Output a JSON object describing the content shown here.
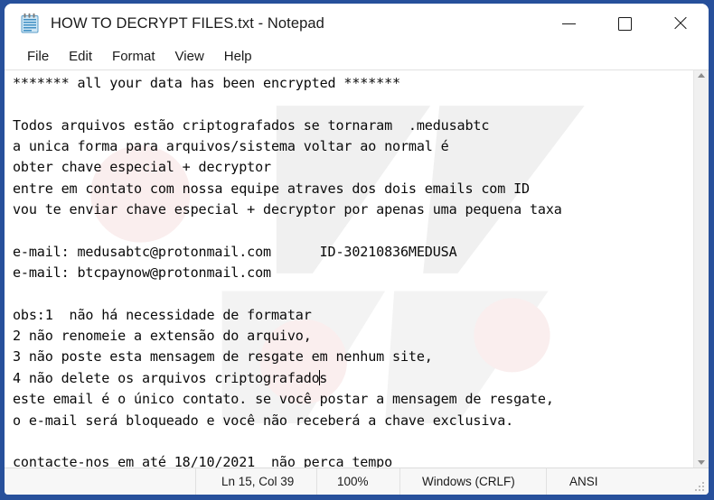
{
  "window": {
    "title": "HOW TO DECRYPT FILES.txt - Notepad",
    "icon": "notepad-icon",
    "frame_color": "#27509b",
    "controls": [
      {
        "name": "minimize-button",
        "label": "—",
        "icon": "minimize-icon"
      },
      {
        "name": "maximize-button",
        "label": "□",
        "icon": "maximize-icon"
      },
      {
        "name": "close-button",
        "label": "✕",
        "icon": "close-icon"
      }
    ]
  },
  "menubar": {
    "items": [
      {
        "label": "File"
      },
      {
        "label": "Edit"
      },
      {
        "label": "Format"
      },
      {
        "label": "View"
      },
      {
        "label": "Help"
      }
    ]
  },
  "document": {
    "lines": [
      "******* all your data has been encrypted *******",
      "",
      "Todos arquivos estão criptografados se tornaram  .medusabtc",
      "a unica forma para arquivos/sistema voltar ao normal é",
      "obter chave especial + decryptor",
      "entre em contato com nossa equipe atraves dos dois emails com ID",
      "vou te enviar chave especial + decryptor por apenas uma pequena taxa",
      "",
      "e-mail: medusabtc@protonmail.com      ID-30210836MEDUSA",
      "e-mail: btcpaynow@protonmail.com",
      "",
      "obs:1  não há necessidade de formatar",
      "2 não renomeie a extensão do arquivo,",
      "3 não poste esta mensagem de resgate em nenhum site,",
      "4 não delete os arquivos criptografados",
      "este email é o único contato. se você postar a mensagem de resgate,",
      "o e-mail será bloqueado e você não receberá a chave exclusiva.",
      "",
      "contacte-nos em até 18/10/2021  não perca tempo"
    ],
    "caret_line_index": 14,
    "caret_column": 38,
    "ransom_note": {
      "extension": ".medusabtc",
      "emails": [
        "medusabtc@protonmail.com",
        "btcpaynow@protonmail.com"
      ],
      "victim_id": "ID-30210836MEDUSA",
      "deadline": "18/10/2021"
    }
  },
  "scrollbar": {
    "up_arrow": "scroll-up-icon",
    "down_arrow": "scroll-down-icon"
  },
  "statusbar": {
    "line_col": "Ln 15, Col 39",
    "zoom": "100%",
    "line_ending": "Windows (CRLF)",
    "encoding": "ANSI"
  }
}
